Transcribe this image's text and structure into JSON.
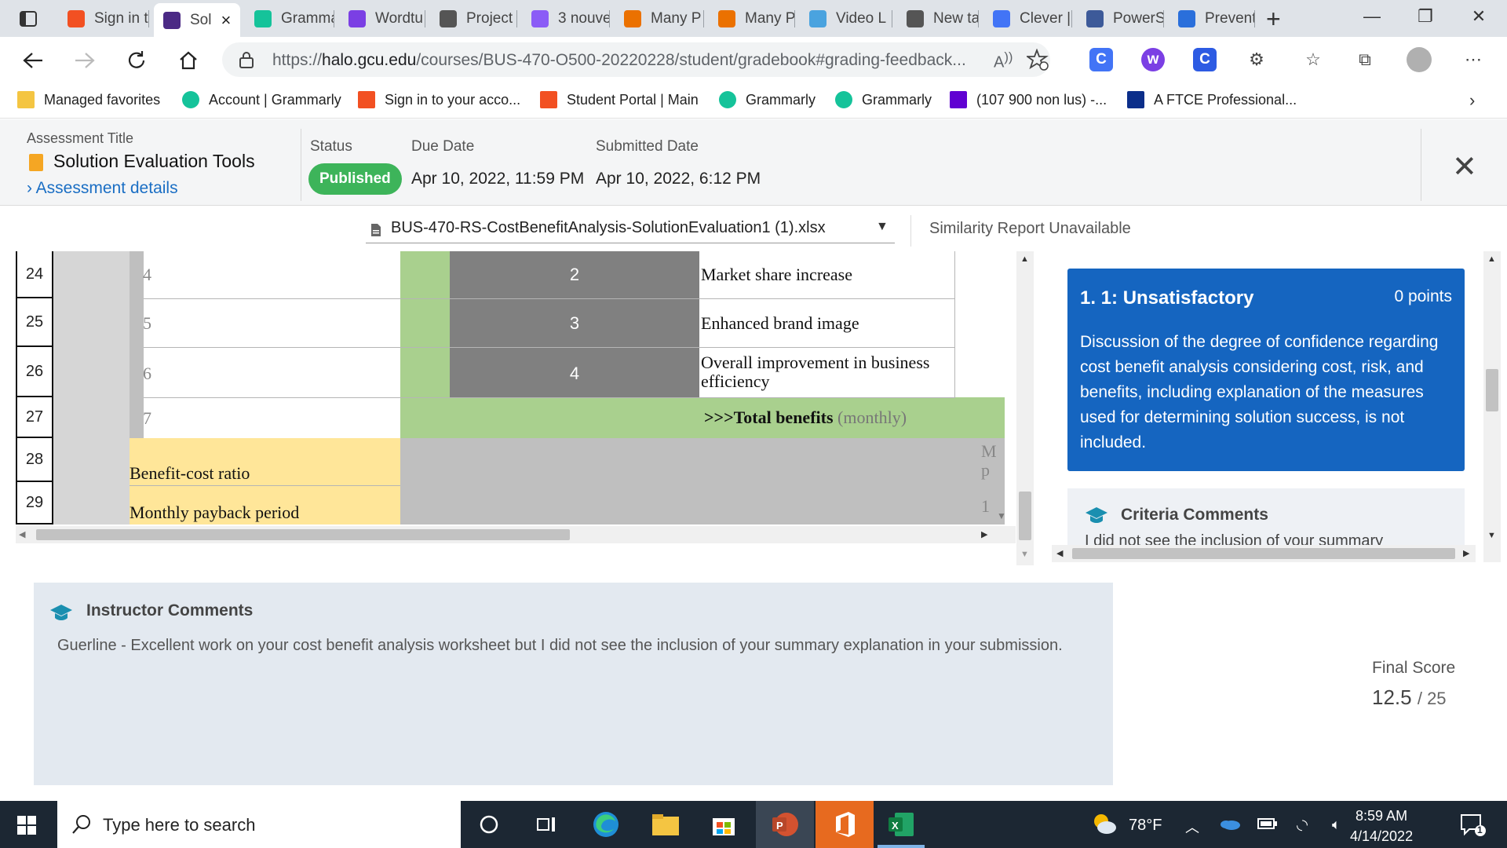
{
  "browser": {
    "tabs": [
      {
        "title": "Sign in t",
        "icon": "microsoft-icon",
        "color": "#f25022"
      },
      {
        "title": "Sol",
        "icon": "halo-icon",
        "color": "#4b2a85",
        "active": true
      },
      {
        "title": "Gramma",
        "icon": "grammarly-icon",
        "color": "#15c39a"
      },
      {
        "title": "Wordtu",
        "icon": "wordtune-icon",
        "color": "#7b3fe4"
      },
      {
        "title": "Project",
        "icon": "github-icon",
        "color": "#555555"
      },
      {
        "title": "3 nouve",
        "icon": "mail-icon",
        "color": "#8b5cf6"
      },
      {
        "title": "Many P",
        "icon": "chegg-icon",
        "color": "#eb7100"
      },
      {
        "title": "Many P",
        "icon": "chegg-icon",
        "color": "#eb7100"
      },
      {
        "title": "Video L",
        "icon": "video-icon",
        "color": "#4aa3df"
      },
      {
        "title": "New tab",
        "icon": "newtab-icon",
        "color": "#555555"
      },
      {
        "title": "Clever |",
        "icon": "clever-icon",
        "color": "#4274f6"
      },
      {
        "title": "PowerS",
        "icon": "powerschool-icon",
        "color": "#3d5a99"
      },
      {
        "title": "Prevent",
        "icon": "prevent-icon",
        "color": "#2a6fdb"
      }
    ],
    "url_prefix": "https://",
    "url_host": "halo.gcu.edu",
    "url_path": "/courses/BUS-470-O500-20220228/student/gradebook#grading-feedback...",
    "favorites": [
      {
        "label": "Managed favorites",
        "icon": "folder-icon"
      },
      {
        "label": "Account | Grammarly",
        "icon": "grammarly-icon"
      },
      {
        "label": "Sign in to your acco...",
        "icon": "microsoft-icon"
      },
      {
        "label": "Student Portal | Main",
        "icon": "microsoft-icon"
      },
      {
        "label": "Grammarly",
        "icon": "grammarly-icon"
      },
      {
        "label": "Grammarly",
        "icon": "grammarly-icon"
      },
      {
        "label": "(107 900 non lus) -...",
        "icon": "yahoo-icon"
      },
      {
        "label": "A FTCE Professional...",
        "icon": "pearson-icon"
      }
    ]
  },
  "assessment": {
    "title_label": "Assessment Title",
    "title": "Solution Evaluation Tools",
    "details_link": "Assessment details",
    "status_label": "Status",
    "status": "Published",
    "due_label": "Due Date",
    "due": "Apr 10, 2022, 11:59 PM",
    "submitted_label": "Submitted Date",
    "submitted": "Apr 10, 2022, 6:12 PM",
    "status_color": "#3db45a"
  },
  "file": {
    "name": "BUS-470-RS-CostBenefitAnalysis-SolutionEvaluation1 (1).xlsx",
    "similarity": "Similarity Report Unavailable"
  },
  "sheet": {
    "rows": [
      {
        "num": "24",
        "idx": "4",
        "rank": "2",
        "benefit": "Market share increase"
      },
      {
        "num": "25",
        "idx": "5",
        "rank": "3",
        "benefit": "Enhanced brand image"
      },
      {
        "num": "26",
        "idx": "6",
        "rank": "4",
        "benefit": "Overall improvement in business efficiency"
      },
      {
        "num": "27",
        "idx": "7",
        "rank": "",
        "benefit": ""
      },
      {
        "num": "28",
        "idx": "",
        "rank": "",
        "benefit": ""
      },
      {
        "num": "29",
        "idx": "",
        "rank": "",
        "benefit": ""
      }
    ],
    "total_benefits_bold": ">>>Total benefits",
    "total_benefits_suffix": "(monthly)",
    "benefit_cost_ratio": "Benefit-cost ratio",
    "monthly_payback": "Monthly payback period",
    "clipped_m": "M",
    "clipped_p": "p",
    "clipped_1": "1"
  },
  "rubric": {
    "title": "1. 1: Unsatisfactory",
    "points": "0 points",
    "description": "Discussion of the degree of confidence regarding cost benefit analysis considering cost, risk, and benefits, including explanation of the measures used for determining solution success, is not included.",
    "criteria_title": "Criteria Comments",
    "criteria_text": "I did not see the inclusion of your summary",
    "card_color": "#1565c0"
  },
  "instructor": {
    "title": "Instructor Comments",
    "text": "Guerline - Excellent work on your cost benefit analysis worksheet but I did not see the inclusion of your summary explanation in your submission."
  },
  "score": {
    "label": "Final Score",
    "value": "12.5",
    "max": "/ 25"
  },
  "taskbar": {
    "search_placeholder": "Type here to search",
    "weather": "78°F",
    "time": "8:59 AM",
    "date": "4/14/2022",
    "notifications": "1"
  }
}
